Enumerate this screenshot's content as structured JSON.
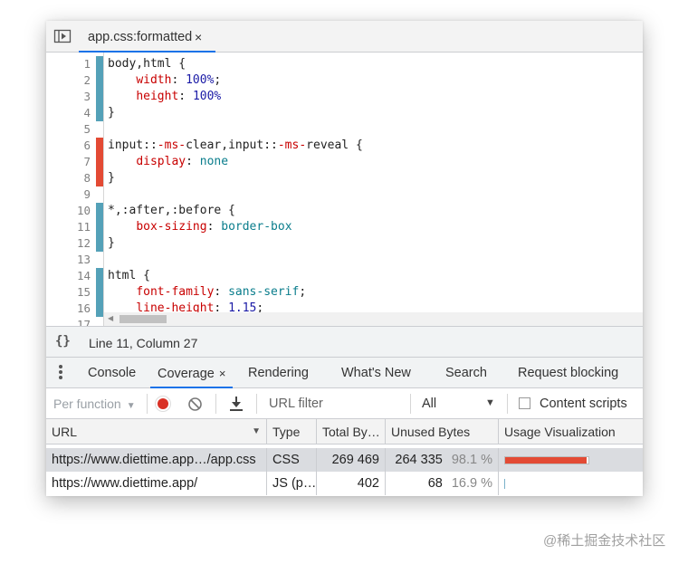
{
  "editor": {
    "tab_label": "app.css:formatted",
    "tab_close": "×",
    "lines": [
      {
        "n": "1",
        "coverage": "used"
      },
      {
        "n": "2",
        "coverage": "used"
      },
      {
        "n": "3",
        "coverage": "used"
      },
      {
        "n": "4",
        "coverage": "used"
      },
      {
        "n": "5",
        "coverage": "none"
      },
      {
        "n": "6",
        "coverage": "unused"
      },
      {
        "n": "7",
        "coverage": "unused"
      },
      {
        "n": "8",
        "coverage": "unused"
      },
      {
        "n": "9",
        "coverage": "none"
      },
      {
        "n": "10",
        "coverage": "used"
      },
      {
        "n": "11",
        "coverage": "used"
      },
      {
        "n": "12",
        "coverage": "used"
      },
      {
        "n": "13",
        "coverage": "none"
      },
      {
        "n": "14",
        "coverage": "used"
      },
      {
        "n": "15",
        "coverage": "used"
      },
      {
        "n": "16",
        "coverage": "used"
      },
      {
        "n": "17",
        "coverage": "none"
      }
    ],
    "code": {
      "l1": "body,html {",
      "l2_prop": "width",
      "l2_val": "100%",
      "l3_prop": "height",
      "l3_val": "100%",
      "l4": "}",
      "l6_a": "input::",
      "l6_b": "-ms-",
      "l6_c": "clear,input::",
      "l6_d": "-ms-",
      "l6_e": "reveal {",
      "l7_prop": "display",
      "l7_val": "none",
      "l8": "}",
      "l10": "*,:after,:before {",
      "l11_prop": "box-sizing",
      "l11_val": "border-box",
      "l12": "}",
      "l14": "html {",
      "l15_prop": "font-family",
      "l15_val": "sans-serif",
      "l16_prop": "line-height",
      "l16_val": "1.15"
    }
  },
  "status": {
    "pretty_print": "{}",
    "cursor": "Line 11, Column 27"
  },
  "drawer": {
    "tabs": [
      {
        "label": "Console"
      },
      {
        "label": "Coverage",
        "active": true
      },
      {
        "label": "Rendering"
      },
      {
        "label": "What's New"
      },
      {
        "label": "Search"
      },
      {
        "label": "Request blocking"
      }
    ],
    "close": "×"
  },
  "coverage_toolbar": {
    "per_function": "Per function",
    "url_filter_placeholder": "URL filter",
    "type_filter": "All",
    "content_scripts": "Content scripts"
  },
  "coverage_table": {
    "headers": {
      "url": "URL",
      "type": "Type",
      "total": "Total By…",
      "unused": "Unused Bytes",
      "viz": "Usage Visualization"
    },
    "rows": [
      {
        "url": "https://www.diettime.app…/app.css",
        "type": "CSS",
        "total": "269 469",
        "unused": "264 335",
        "pct": "98.1 %",
        "unused_fraction": 0.981,
        "size_fraction": 1.0,
        "selected": true
      },
      {
        "url": "https://www.diettime.app/",
        "type": "JS (p…",
        "total": "402",
        "unused": "68",
        "pct": "16.9 %",
        "unused_fraction": 0.169,
        "size_fraction": 0.0015,
        "selected": false
      }
    ]
  },
  "colors": {
    "used": "#54a1b8",
    "unused": "#e34a34",
    "accent": "#1a73e8",
    "record": "#d93025"
  },
  "watermark": "@稀土掘金技术社区"
}
